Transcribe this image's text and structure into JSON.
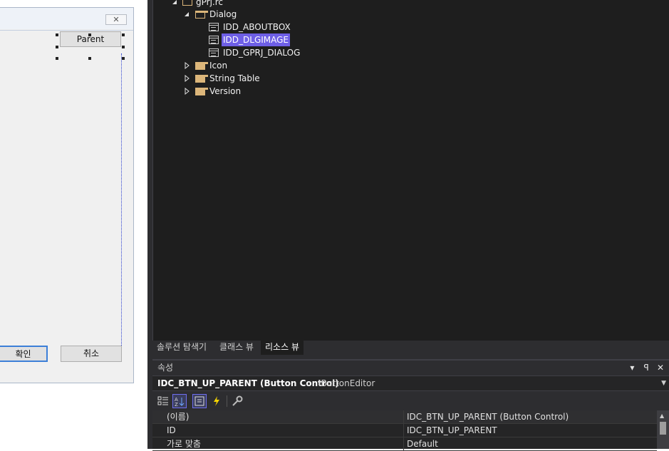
{
  "dialog_editor": {
    "close_glyph": "✕",
    "buttons": {
      "parent": "Parent",
      "ok": "확인",
      "cancel": "취소"
    }
  },
  "resource_view": {
    "tree": [
      {
        "label": "gPrj.rc",
        "icon": "folder-open-icon",
        "expanded": true
      },
      {
        "label": "Dialog",
        "icon": "folder-open-icon",
        "expanded": true
      },
      {
        "label": "IDD_ABOUTBOX",
        "icon": "dialog-resource-icon"
      },
      {
        "label": "IDD_DLGIMAGE",
        "icon": "dialog-resource-icon",
        "selected": true
      },
      {
        "label": "IDD_GPRJ_DIALOG",
        "icon": "dialog-resource-icon"
      },
      {
        "label": "Icon",
        "icon": "folder-icon",
        "expanded": false
      },
      {
        "label": "String Table",
        "icon": "folder-icon",
        "expanded": false
      },
      {
        "label": "Version",
        "icon": "folder-icon",
        "expanded": false
      }
    ],
    "selection_color": "#6e5fe6",
    "folder_color": "#dcb67a"
  },
  "tabs": [
    "솔루션 탐색기",
    "클래스 뷰",
    "리소스 뷰"
  ],
  "active_tab": "리소스 뷰",
  "properties": {
    "title": "속성",
    "window_controls": {
      "menu": "▾",
      "pin": "ꟼ",
      "close": "✕"
    },
    "object_name": "IDC_BTN_UP_PARENT (Button Control)",
    "object_type": "IButtonEditor",
    "toolbar": [
      "categorized-icon",
      "alphabetical-icon",
      "properties-icon",
      "events-icon",
      "property-pages-icon"
    ],
    "rows": [
      {
        "name": "(이름)",
        "value": "IDC_BTN_UP_PARENT (Button Control)"
      },
      {
        "name": "ID",
        "value": "IDC_BTN_UP_PARENT"
      },
      {
        "name": "가로 맞춤",
        "value": "Default"
      }
    ]
  }
}
